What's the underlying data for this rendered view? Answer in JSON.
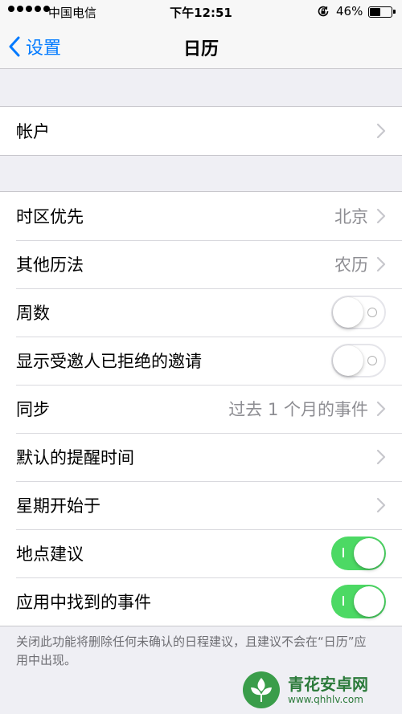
{
  "status_bar": {
    "carrier": "中国电信",
    "time": "下午12:51",
    "battery_text": "46%",
    "battery_level": 0.46
  },
  "nav": {
    "back_label": "设置",
    "title": "日历"
  },
  "group1": {
    "items": [
      {
        "label": "帐户",
        "type": "chevron"
      }
    ]
  },
  "group2": {
    "items": [
      {
        "label": "时区优先",
        "detail": "北京",
        "type": "chevron"
      },
      {
        "label": "其他历法",
        "detail": "农历",
        "type": "chevron"
      },
      {
        "label": "周数",
        "type": "toggle",
        "on": false
      },
      {
        "label": "显示受邀人已拒绝的邀请",
        "type": "toggle",
        "on": false
      },
      {
        "label": "同步",
        "detail": "过去 1 个月的事件",
        "type": "chevron"
      },
      {
        "label": "默认的提醒时间",
        "type": "chevron"
      },
      {
        "label": "星期开始于",
        "type": "chevron"
      },
      {
        "label": "地点建议",
        "type": "toggle",
        "on": true
      },
      {
        "label": "应用中找到的事件",
        "type": "toggle",
        "on": true
      }
    ]
  },
  "footer_text": "关闭此功能将删除任何未确认的日程建议，且建议不会在“日历”应用中出现。",
  "watermark": {
    "title": "青花安卓网",
    "url": "www.qhhlv.com"
  },
  "colors": {
    "accent": "#007aff",
    "toggle_on": "#4cd964",
    "background": "#efeff4"
  }
}
